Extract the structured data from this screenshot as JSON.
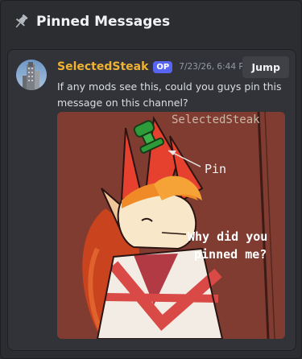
{
  "header": {
    "title": "Pinned Messages",
    "icon": "pin-icon"
  },
  "message": {
    "username": "SelectedSteak",
    "badge": "OP",
    "timestamp": "7/23/26, 6:44 PM",
    "text": "If any mods see this, could you guys pin this message on this channel?",
    "jump_label": "Jump",
    "image": {
      "signature": "SelectedSteak",
      "pin_label": "Pin",
      "caption_line1": "Why did you",
      "caption_line2": "pinned me?"
    }
  },
  "colors": {
    "background": "#2b2d31",
    "card": "#313338",
    "username": "#f0b232",
    "badge": "#5865f2"
  }
}
